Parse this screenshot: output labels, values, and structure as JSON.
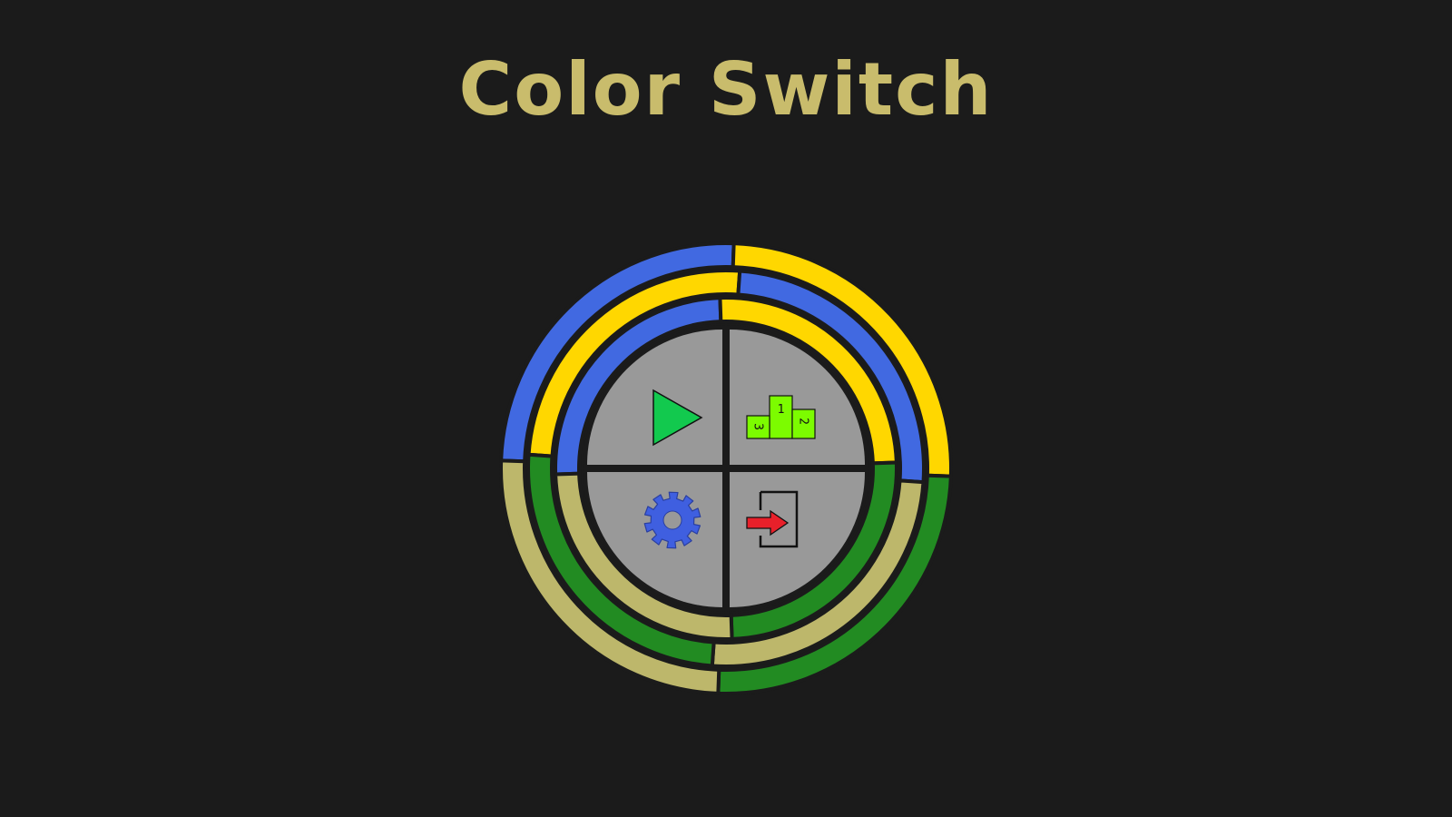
{
  "game": {
    "title": "Color Switch"
  },
  "menu": {
    "rings": [
      {
        "name": "outer-ring",
        "segments": [
          "#4169e1",
          "#ffd700",
          "#228b22",
          "#bdb76b"
        ],
        "offset_deg": 2
      },
      {
        "name": "middle-ring",
        "segments": [
          "#ffd700",
          "#4169e1",
          "#bdb76b",
          "#228b22"
        ],
        "offset_deg": 4
      },
      {
        "name": "inner-ring",
        "segments": [
          "#4169e1",
          "#ffd700",
          "#228b22",
          "#bdb76b"
        ],
        "offset_deg": -2
      }
    ],
    "buttons": {
      "play": {
        "icon": "play-icon"
      },
      "leaderboard": {
        "icon": "podium-icon",
        "ranks": [
          "1",
          "2",
          "3"
        ]
      },
      "settings": {
        "icon": "gear-icon"
      },
      "exit": {
        "icon": "exit-door-icon"
      }
    },
    "colors": {
      "background": "#1b1b1b",
      "title": "#c9bc6c",
      "quadrant": "#999999",
      "play": "#12c94e",
      "podium": "#7cfc00",
      "gear": "#3f5fe0",
      "arrow": "#e8202a"
    }
  }
}
